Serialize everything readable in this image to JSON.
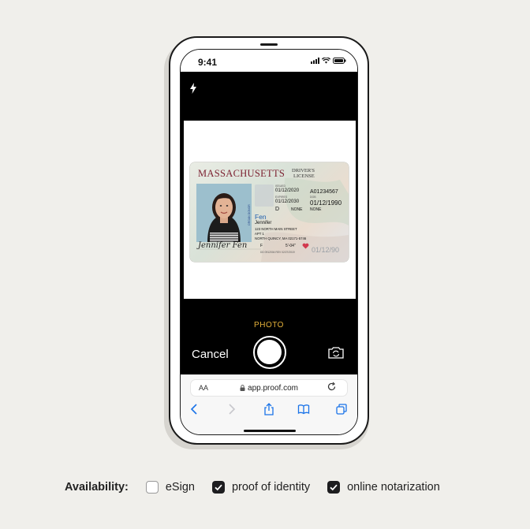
{
  "status_bar": {
    "time": "9:41"
  },
  "camera": {
    "mode_label": "PHOTO",
    "cancel_label": "Cancel"
  },
  "license": {
    "state": "MASSACHUSETTS",
    "doc_type_line1": "DRIVER'S",
    "doc_type_line2": "LICENSE",
    "issue_date": "01/12/2020",
    "license_number": "A01234567",
    "expiry_date": "01/12/2030",
    "dob": "01/12/1990",
    "class": "D",
    "restrictions": "NONE",
    "endorsements": "NONE",
    "last_name": "Fen",
    "first_name": "Jennifer",
    "address_line1": "123 NORTH MAIN STREET",
    "address_line2": "APT 1",
    "address_line3": "NORTH QUINCY, MA 02171-5746",
    "sex": "F",
    "height": "5'-04\"",
    "signature": "Jennifer Fen",
    "ghost_dob": "01/12/90",
    "vertical_tag": "ORGAN DONOR",
    "small_field_label_1": "ISSUED",
    "small_field_label_2": "EXPIRES",
    "small_field_label_3": "DOB",
    "small_line": "DD 0912004 REV 02/27/2019"
  },
  "browser": {
    "aa_label": "AA",
    "url": "app.proof.com"
  },
  "availability": {
    "label": "Availability:",
    "options": [
      {
        "label": "eSign",
        "checked": false
      },
      {
        "label": "proof of identity",
        "checked": true
      },
      {
        "label": "online notarization",
        "checked": true
      }
    ]
  },
  "colors": {
    "background": "#f0efeb",
    "accent_photo": "#e5b13a",
    "license_state": "#7b1f2f",
    "ios_blue": "#1a73e8"
  }
}
